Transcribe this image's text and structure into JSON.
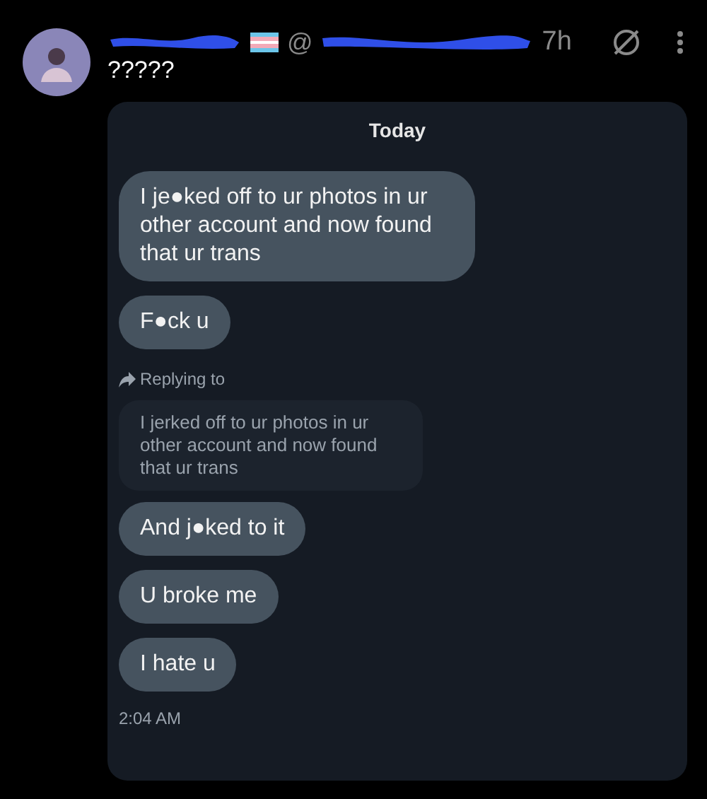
{
  "post": {
    "handle_prefix": "@",
    "time": "7h",
    "text": "?????"
  },
  "conversation": {
    "day": "Today",
    "items": [
      {
        "kind": "message",
        "text": "I je●ked off to ur photos in ur other account and now found that ur trans"
      },
      {
        "kind": "message",
        "text": "F●ck u"
      },
      {
        "kind": "reply_label",
        "text": "Replying to"
      },
      {
        "kind": "quoted",
        "text": "I jerked off to ur photos in ur other account and now found that ur trans"
      },
      {
        "kind": "message",
        "text": "And j●ked to it"
      },
      {
        "kind": "message",
        "text": "U broke me"
      },
      {
        "kind": "message",
        "text": "I hate u"
      },
      {
        "kind": "time",
        "text": "2:04 AM"
      }
    ]
  }
}
